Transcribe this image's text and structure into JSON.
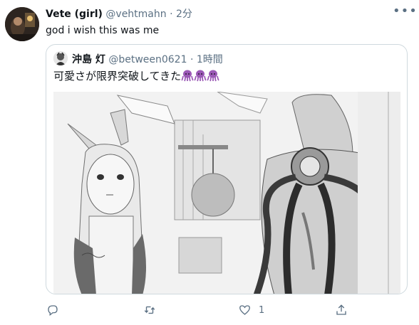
{
  "tweet": {
    "author_name": "Vete (girl)",
    "author_handle": "@vehtmahn",
    "separator": "·",
    "time": "2分",
    "text": "god i wish this was me",
    "more_label": "•••"
  },
  "quoted": {
    "author_name": "沖島 灯",
    "author_handle": "@between0621",
    "separator": "·",
    "time": "1時間",
    "text": "可愛さが限界突破してきた",
    "emoji_count": 3
  },
  "actions": {
    "reply_count": "",
    "retweet_count": "",
    "like_count": "1",
    "share_count": ""
  },
  "colors": {
    "text": "#0f1419",
    "secondary": "#5b7083",
    "border": "#cfd9de",
    "emoji": "#9b59b6"
  }
}
